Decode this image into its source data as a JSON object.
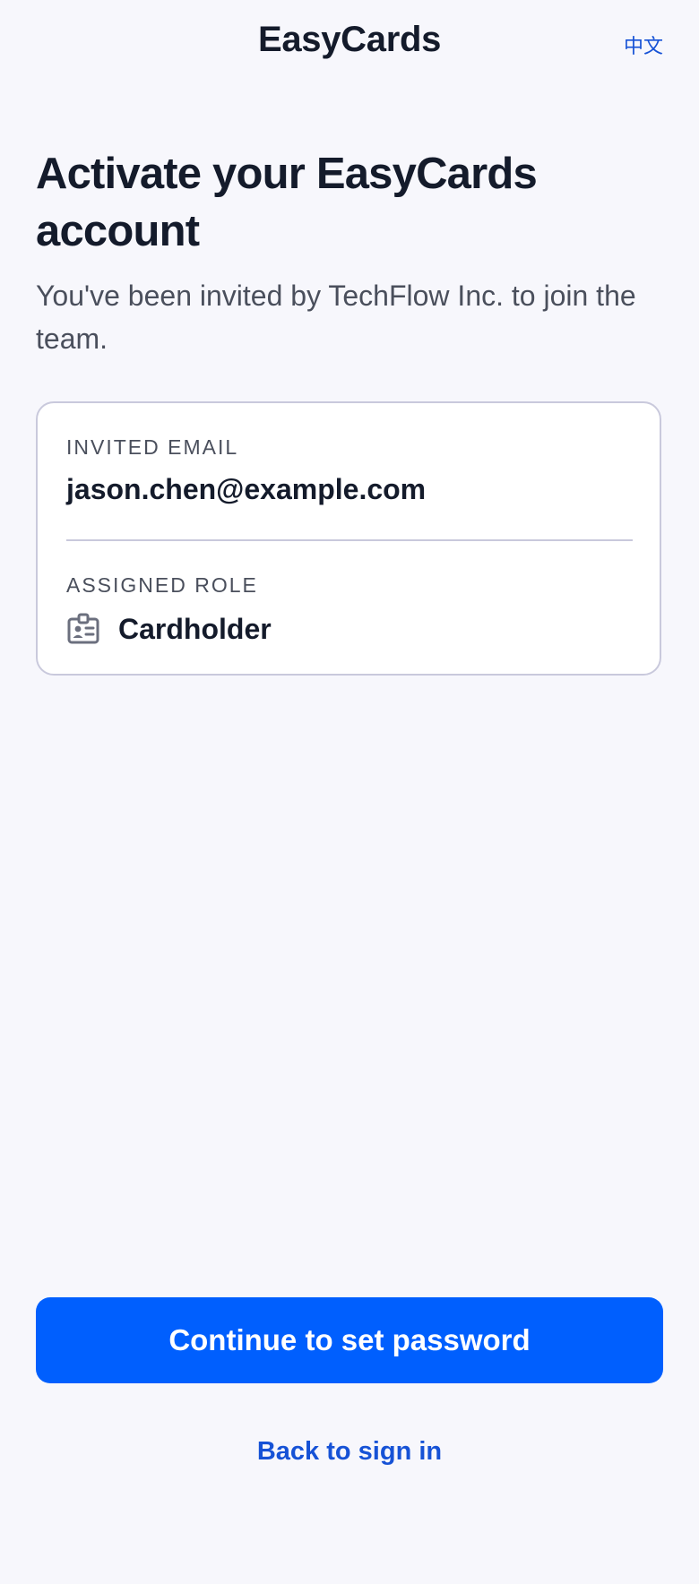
{
  "header": {
    "title": "EasyCards",
    "language_toggle": "中文"
  },
  "main": {
    "title": "Activate your EasyCards account",
    "subtitle": "You've been invited by TechFlow Inc. to join the team."
  },
  "invite_card": {
    "email_label": "INVITED EMAIL",
    "email_value": "jason.chen@example.com",
    "role_label": "ASSIGNED ROLE",
    "role_value": "Cardholder",
    "role_icon": "id-badge-icon"
  },
  "actions": {
    "primary_label": "Continue to set password",
    "secondary_label": "Back to sign in"
  },
  "colors": {
    "background": "#f7f7fc",
    "primary": "#005ffe",
    "link": "#1652d6",
    "text": "#141b2b",
    "muted": "#4a4f5c",
    "border": "#c9c9dc"
  }
}
